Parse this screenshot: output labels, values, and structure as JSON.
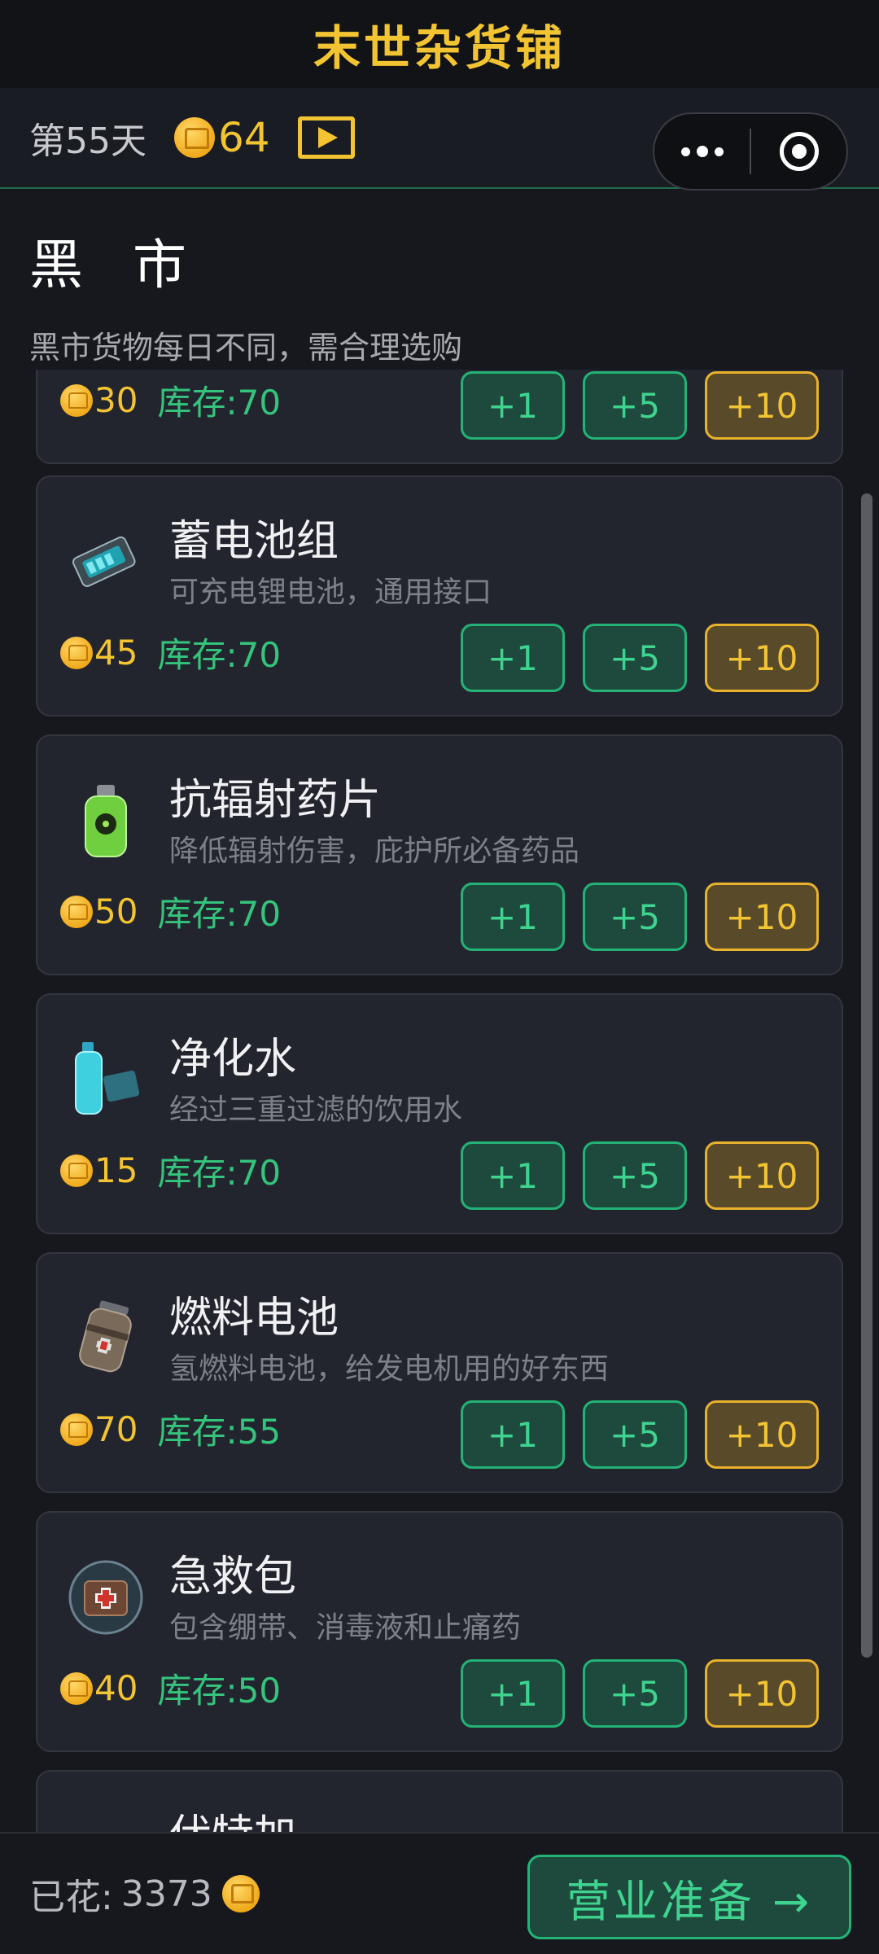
{
  "app": {
    "title": "末世杂货铺"
  },
  "status": {
    "day": "第55天",
    "coins": "64"
  },
  "section": {
    "title": "黑 市",
    "subtitle": "黑市货物每日不同，需合理选购"
  },
  "buttons": {
    "plus1": "+1",
    "plus5": "+5",
    "plus10": "+10"
  },
  "items": [
    {
      "name": "",
      "desc": "",
      "price": "30",
      "stock": "库存:70",
      "icon": "partial-item-icon"
    },
    {
      "name": "蓄电池组",
      "desc": "可充电锂电池，通用接口",
      "price": "45",
      "stock": "库存:70",
      "icon": "battery-pack-icon"
    },
    {
      "name": "抗辐射药片",
      "desc": "降低辐射伤害，庇护所必备药品",
      "price": "50",
      "stock": "库存:70",
      "icon": "radiation-pill-bottle-icon"
    },
    {
      "name": "净化水",
      "desc": "经过三重过滤的饮用水",
      "price": "15",
      "stock": "库存:70",
      "icon": "water-bottle-icon"
    },
    {
      "name": "燃料电池",
      "desc": "氢燃料电池，给发电机用的好东西",
      "price": "70",
      "stock": "库存:55",
      "icon": "fuel-cell-icon"
    },
    {
      "name": "急救包",
      "desc": "包含绷带、消毒液和止痛药",
      "price": "40",
      "stock": "库存:50",
      "icon": "first-aid-kit-icon"
    },
    {
      "name": "伏特加",
      "desc": "",
      "price": "",
      "stock": "",
      "icon": "vodka-bottle-icon"
    }
  ],
  "footer": {
    "spent_label": "已花:",
    "spent_value": "3373",
    "cta": "营业准备 →"
  },
  "colors": {
    "gold": "#f3c431",
    "green": "#34c47c",
    "bg": "#16181e",
    "card": "#23252e"
  }
}
